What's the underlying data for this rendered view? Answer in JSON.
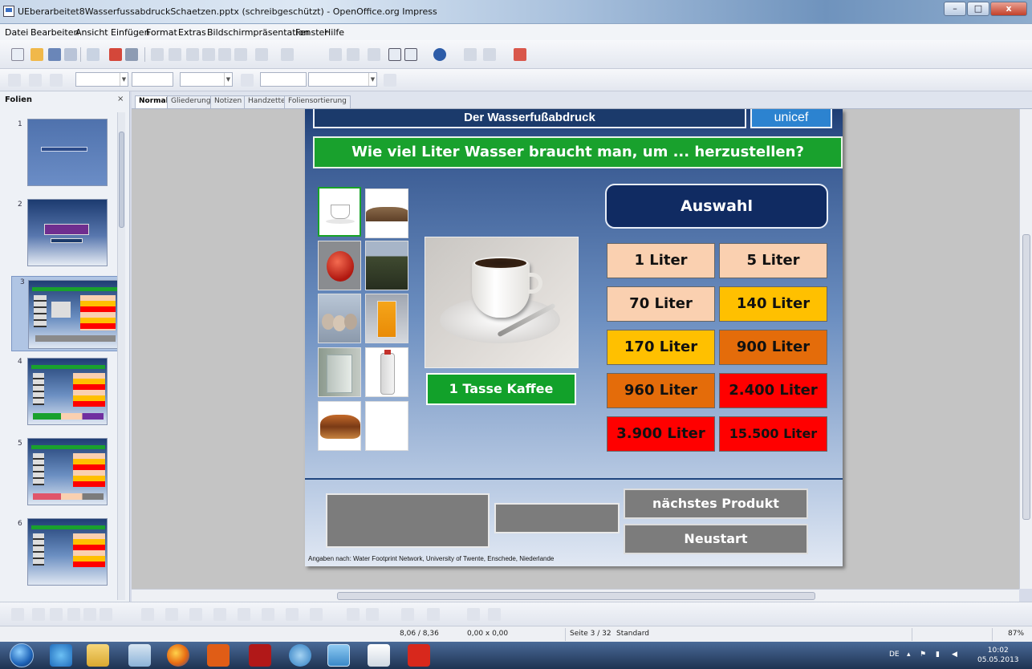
{
  "window": {
    "title": "UEberarbeitet8WasserfussabdruckSchaetzen.pptx (schreibgeschützt) - OpenOffice.org Impress",
    "minimize": "–",
    "maximize": "□",
    "close": "x"
  },
  "menu": [
    "Datei",
    "Bearbeiten",
    "Ansicht",
    "Einfügen",
    "Format",
    "Extras",
    "Bildschirmpräsentation",
    "Fenster",
    "Hilfe"
  ],
  "slides_panel": {
    "title": "Folien",
    "close": "×",
    "thumbs": [
      "1",
      "2",
      "3",
      "4",
      "5",
      "6"
    ],
    "selected": "3"
  },
  "view_tabs": [
    "Normal",
    "Gliederung",
    "Notizen",
    "Handzettel",
    "Foliensortierung"
  ],
  "slide": {
    "header": "Der Wasserfußabdruck",
    "logo": "unicef",
    "question": "Wie viel Liter Wasser braucht man, um ... herzustellen?",
    "product_label": "1 Tasse Kaffee",
    "selection_title": "Auswahl",
    "options": [
      {
        "label": "1 Liter",
        "color": "#fad0b0"
      },
      {
        "label": "5 Liter",
        "color": "#fad0b0"
      },
      {
        "label": "70 Liter",
        "color": "#fad0b0"
      },
      {
        "label": "140 Liter",
        "color": "#ffc000"
      },
      {
        "label": "170 Liter",
        "color": "#ffc000"
      },
      {
        "label": "900 Liter",
        "color": "#e46c0a"
      },
      {
        "label": "960 Liter",
        "color": "#e46c0a"
      },
      {
        "label": "2.400 Liter",
        "color": "#ff0000"
      },
      {
        "label": "3.900 Liter",
        "color": "#ff0000"
      },
      {
        "label": "15.500 Liter",
        "color": "#ff0000"
      }
    ],
    "next_button": "nächstes Produkt",
    "restart_button": "Neustart",
    "source": "Angaben nach: Water Footprint Network, University of Twente, Enschede, Niederlande"
  },
  "status": {
    "position": "8,06 / 8,36",
    "size": "0,00 x 0,00",
    "page": "Seite 3 / 32",
    "layout": "Standard",
    "zoom": "87%"
  },
  "taskbar": {
    "lang": "DE",
    "time": "10:02",
    "date": "05.05.2013"
  }
}
